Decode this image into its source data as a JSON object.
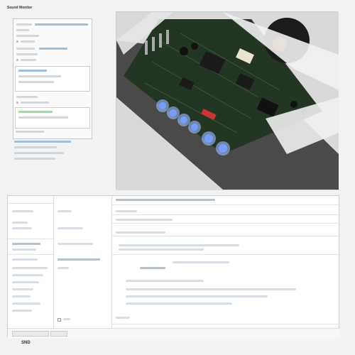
{
  "top_left": {
    "title": "Sound Monitor"
  },
  "photo": {
    "alt": "Circuit board with illuminated blue LEDs inside a metal enclosure"
  },
  "bottom": {
    "header_left": "",
    "header_mid": "",
    "header_right": ""
  },
  "footer": {
    "brand": "SND"
  },
  "colors": {
    "led": "#3a6cff",
    "board": "#243624"
  }
}
